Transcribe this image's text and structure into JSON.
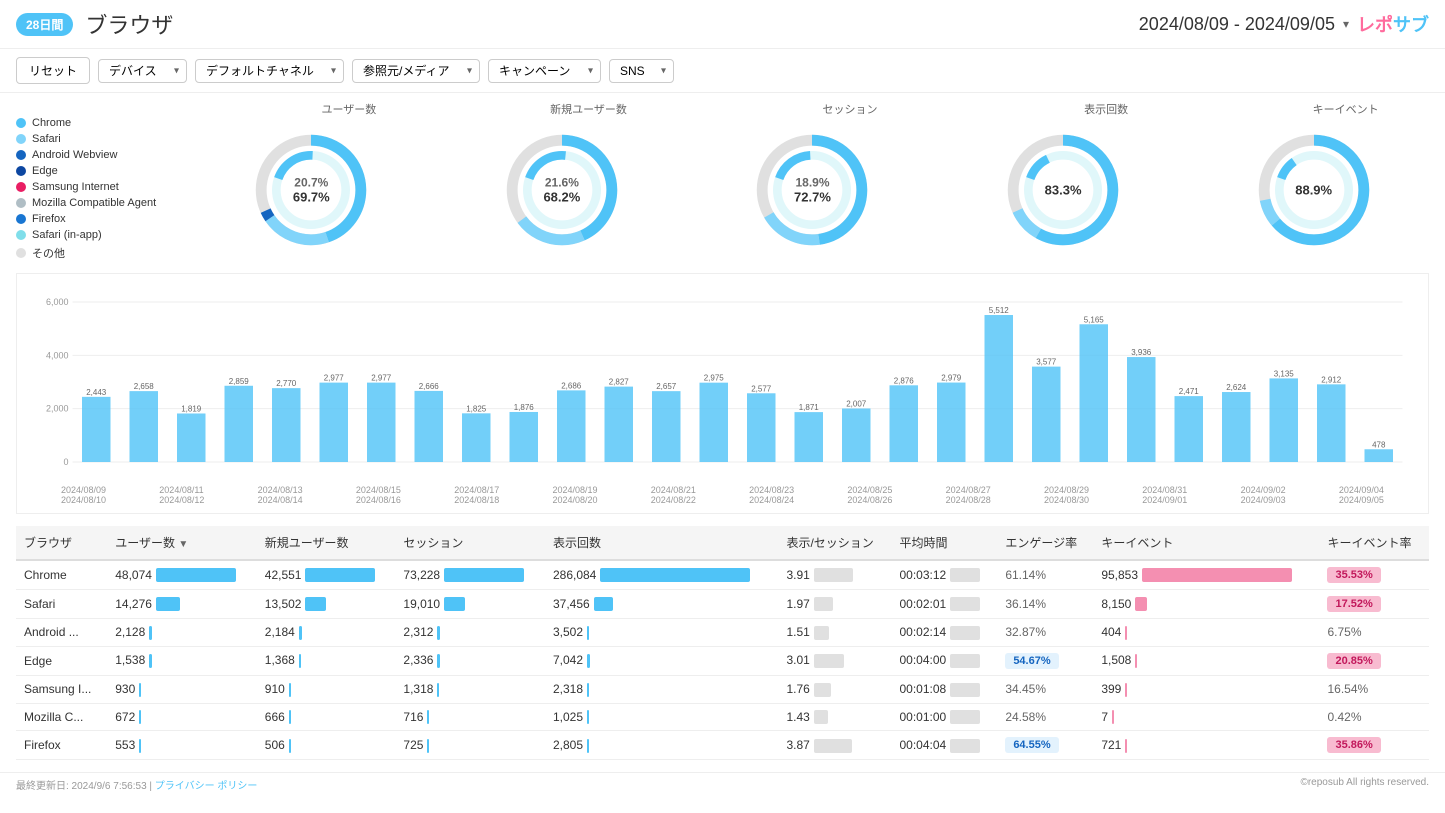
{
  "header": {
    "badge": "28日間",
    "title": "ブラウザ",
    "date_range": "2024/08/09 - 2024/09/05",
    "logo": "レポサブ"
  },
  "filters": {
    "reset": "リセット",
    "device": "デバイス",
    "channel": "デフォルトチャネル",
    "source": "参照元/メディア",
    "campaign": "キャンペーン",
    "sns": "SNS"
  },
  "legend": [
    {
      "label": "Chrome",
      "color": "#4fc3f7"
    },
    {
      "label": "Safari",
      "color": "#81d4fa"
    },
    {
      "label": "Android Webview",
      "color": "#1565c0"
    },
    {
      "label": "Edge",
      "color": "#0d47a1"
    },
    {
      "label": "Samsung Internet",
      "color": "#e91e63"
    },
    {
      "label": "Mozilla Compatible Agent",
      "color": "#b0bec5"
    },
    {
      "label": "Firefox",
      "color": "#1976d2"
    },
    {
      "label": "Safari (in-app)",
      "color": "#80deea"
    },
    {
      "label": "その他",
      "color": "#e0e0e0"
    }
  ],
  "donuts": [
    {
      "label": "ユーザー数",
      "center1": "20.7%",
      "center2": "69.7%",
      "large": 69.7,
      "small": 20.7
    },
    {
      "label": "新規ユーザー数",
      "center1": "21.6%",
      "center2": "68.2%",
      "large": 68.2,
      "small": 21.6
    },
    {
      "label": "セッション",
      "center1": "18.9%",
      "center2": "72.7%",
      "large": 72.7,
      "small": 18.9
    },
    {
      "label": "表示回数",
      "center1": "",
      "center2": "83.3%",
      "large": 83.3,
      "small": 10
    },
    {
      "label": "キーイベント",
      "center1": "",
      "center2": "88.9%",
      "large": 88.9,
      "small": 8
    }
  ],
  "bar_chart": {
    "y_labels": [
      "6,000",
      "4,000",
      "2,000",
      "0"
    ],
    "dates": [
      "2024/08/09",
      "2024/08/10",
      "2024/08/11",
      "2024/08/12",
      "2024/08/13",
      "2024/08/14",
      "2024/08/15",
      "2024/08/16",
      "2024/08/17",
      "2024/08/18",
      "2024/08/19",
      "2024/08/20",
      "2024/08/21",
      "2024/08/22",
      "2024/08/23",
      "2024/08/24",
      "2024/08/25",
      "2024/08/26",
      "2024/08/27",
      "2024/08/28",
      "2024/08/29",
      "2024/08/30",
      "2024/08/31",
      "2024/09/01",
      "2024/09/02",
      "2024/09/03",
      "2024/09/04",
      "2024/09/05"
    ],
    "values": [
      2443,
      2658,
      1819,
      2859,
      2770,
      2977,
      2977,
      2666,
      1825,
      1876,
      2686,
      2827,
      2657,
      2975,
      2577,
      1871,
      2007,
      2876,
      2979,
      5512,
      3577,
      5165,
      3936,
      2471,
      2624,
      3135,
      2912,
      478
    ]
  },
  "table": {
    "headers": [
      "ブラウザ",
      "ユーザー数 ▼",
      "新規ユーザー数",
      "セッション",
      "表示回数",
      "表示/セッション",
      "平均時間",
      "エンゲージ率",
      "キーイベント",
      "キーイベント率"
    ],
    "rows": [
      {
        "name": "Chrome",
        "users": 48074,
        "new_users": 42551,
        "sessions": 73228,
        "views": 286084,
        "views_per_session": "3.91",
        "avg_time": "00:03:12",
        "engage": "61.14%",
        "key_events": 95853,
        "key_rate": "35.53%",
        "users_bar": 100,
        "sessions_bar": 100,
        "views_bar": 100,
        "key_events_bar": 100,
        "key_rate_badge": "pink"
      },
      {
        "name": "Safari",
        "users": 14276,
        "new_users": 13502,
        "sessions": 19010,
        "views": 37456,
        "views_per_session": "1.97",
        "avg_time": "00:02:01",
        "engage": "36.14%",
        "key_events": 8150,
        "key_rate": "17.52%",
        "users_bar": 30,
        "sessions_bar": 26,
        "views_bar": 13,
        "key_events_bar": 8,
        "key_rate_badge": "pink"
      },
      {
        "name": "Android ...",
        "users": 2128,
        "new_users": 2184,
        "sessions": 2312,
        "views": 3502,
        "views_per_session": "1.51",
        "avg_time": "00:02:14",
        "engage": "32.87%",
        "key_events": 404,
        "key_rate": "6.75%",
        "users_bar": 4,
        "sessions_bar": 3,
        "views_bar": 1,
        "key_events_bar": 0,
        "key_rate_badge": "none"
      },
      {
        "name": "Edge",
        "users": 1538,
        "new_users": 1368,
        "sessions": 2336,
        "views": 7042,
        "views_per_session": "3.01",
        "avg_time": "00:04:00",
        "engage": "54.67%",
        "key_events": 1508,
        "key_rate": "20.85%",
        "users_bar": 3,
        "sessions_bar": 3,
        "views_bar": 2,
        "key_events_bar": 1,
        "key_rate_badge": "pink",
        "engage_badge": "blue"
      },
      {
        "name": "Samsung I...",
        "users": 930,
        "new_users": 910,
        "sessions": 1318,
        "views": 2318,
        "views_per_session": "1.76",
        "avg_time": "00:01:08",
        "engage": "34.45%",
        "key_events": 399,
        "key_rate": "16.54%",
        "users_bar": 2,
        "sessions_bar": 2,
        "views_bar": 1,
        "key_events_bar": 0,
        "key_rate_badge": "none"
      },
      {
        "name": "Mozilla C...",
        "users": 672,
        "new_users": 666,
        "sessions": 716,
        "views": 1025,
        "views_per_session": "1.43",
        "avg_time": "00:01:00",
        "engage": "24.58%",
        "key_events": 7,
        "key_rate": "0.42%",
        "users_bar": 1,
        "sessions_bar": 1,
        "views_bar": 0,
        "key_events_bar": 0,
        "key_rate_badge": "none"
      },
      {
        "name": "Firefox",
        "users": 553,
        "new_users": 506,
        "sessions": 725,
        "views": 2805,
        "views_per_session": "3.87",
        "avg_time": "00:04:04",
        "engage": "64.55%",
        "key_events": 721,
        "key_rate": "35.86%",
        "users_bar": 1,
        "sessions_bar": 1,
        "views_bar": 1,
        "key_events_bar": 1,
        "key_rate_badge": "pink",
        "engage_badge": "blue"
      }
    ]
  },
  "footer": {
    "updated": "最終更新日: 2024/9/6 7:56:53 |",
    "privacy_link": "プライバシー ポリシー",
    "copyright": "©reposub All rights reserved."
  }
}
